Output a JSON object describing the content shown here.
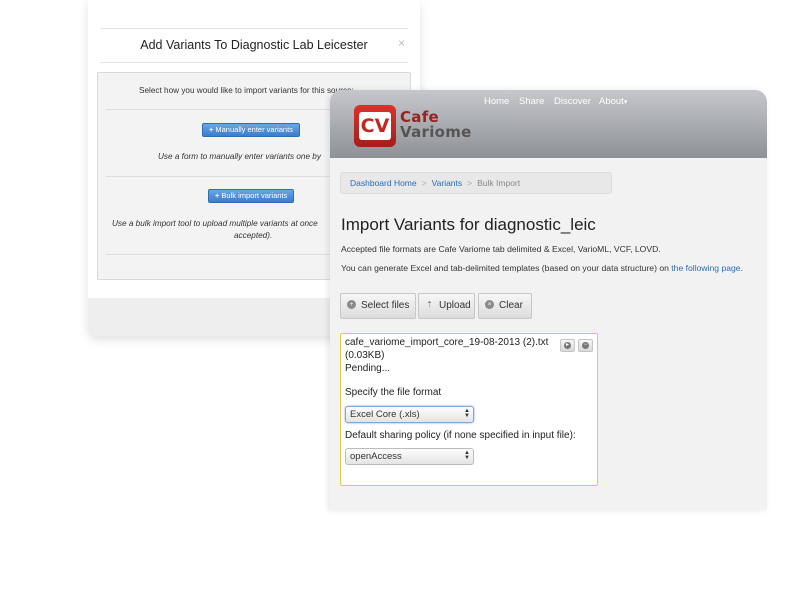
{
  "modal": {
    "title": "Add Variants To Diagnostic Lab Leicester",
    "close": "×",
    "intro": "Select how you would like to import variants for this source:",
    "manual_button": "Manually enter variants",
    "manual_desc": "Use a form to manually enter variants one by",
    "bulk_button": "Bulk import variants",
    "bulk_desc_line1": "Use a bulk import tool to upload multiple variants at once",
    "bulk_desc_line2": "accepted)."
  },
  "app": {
    "logo_mark": "CV",
    "logo_line1": "Cafe",
    "logo_line2": "Variome",
    "nav": {
      "home": "Home",
      "share": "Share",
      "discover": "Discover",
      "about": "About",
      "about_caret": "▾"
    },
    "breadcrumb": {
      "item1": "Dashboard Home",
      "item2": "Variants",
      "current": "Bulk Import",
      "separator": ">"
    },
    "page_title": "Import Variants for diagnostic_leic",
    "formats_text": "Accepted file formats are Cafe Variome tab delimited & Excel, VarioML, VCF, LOVD.",
    "templates_text": "You can generate Excel and tab-delimited templates (based on your data structure) on",
    "templates_link": "the following page",
    "templates_end": ".",
    "toolbar": {
      "select_files": "Select files",
      "upload": "Upload",
      "clear": "Clear"
    },
    "file": {
      "name": "cafe_variome_import_core_19-08-2013 (2).txt",
      "size": "(0.03KB)",
      "status": "Pending...",
      "format_label": "Specify the file format",
      "format_value": "Excel Core (.xls)",
      "sharing_label": "Default sharing policy (if none specified in input file):",
      "sharing_value": "openAccess"
    }
  }
}
